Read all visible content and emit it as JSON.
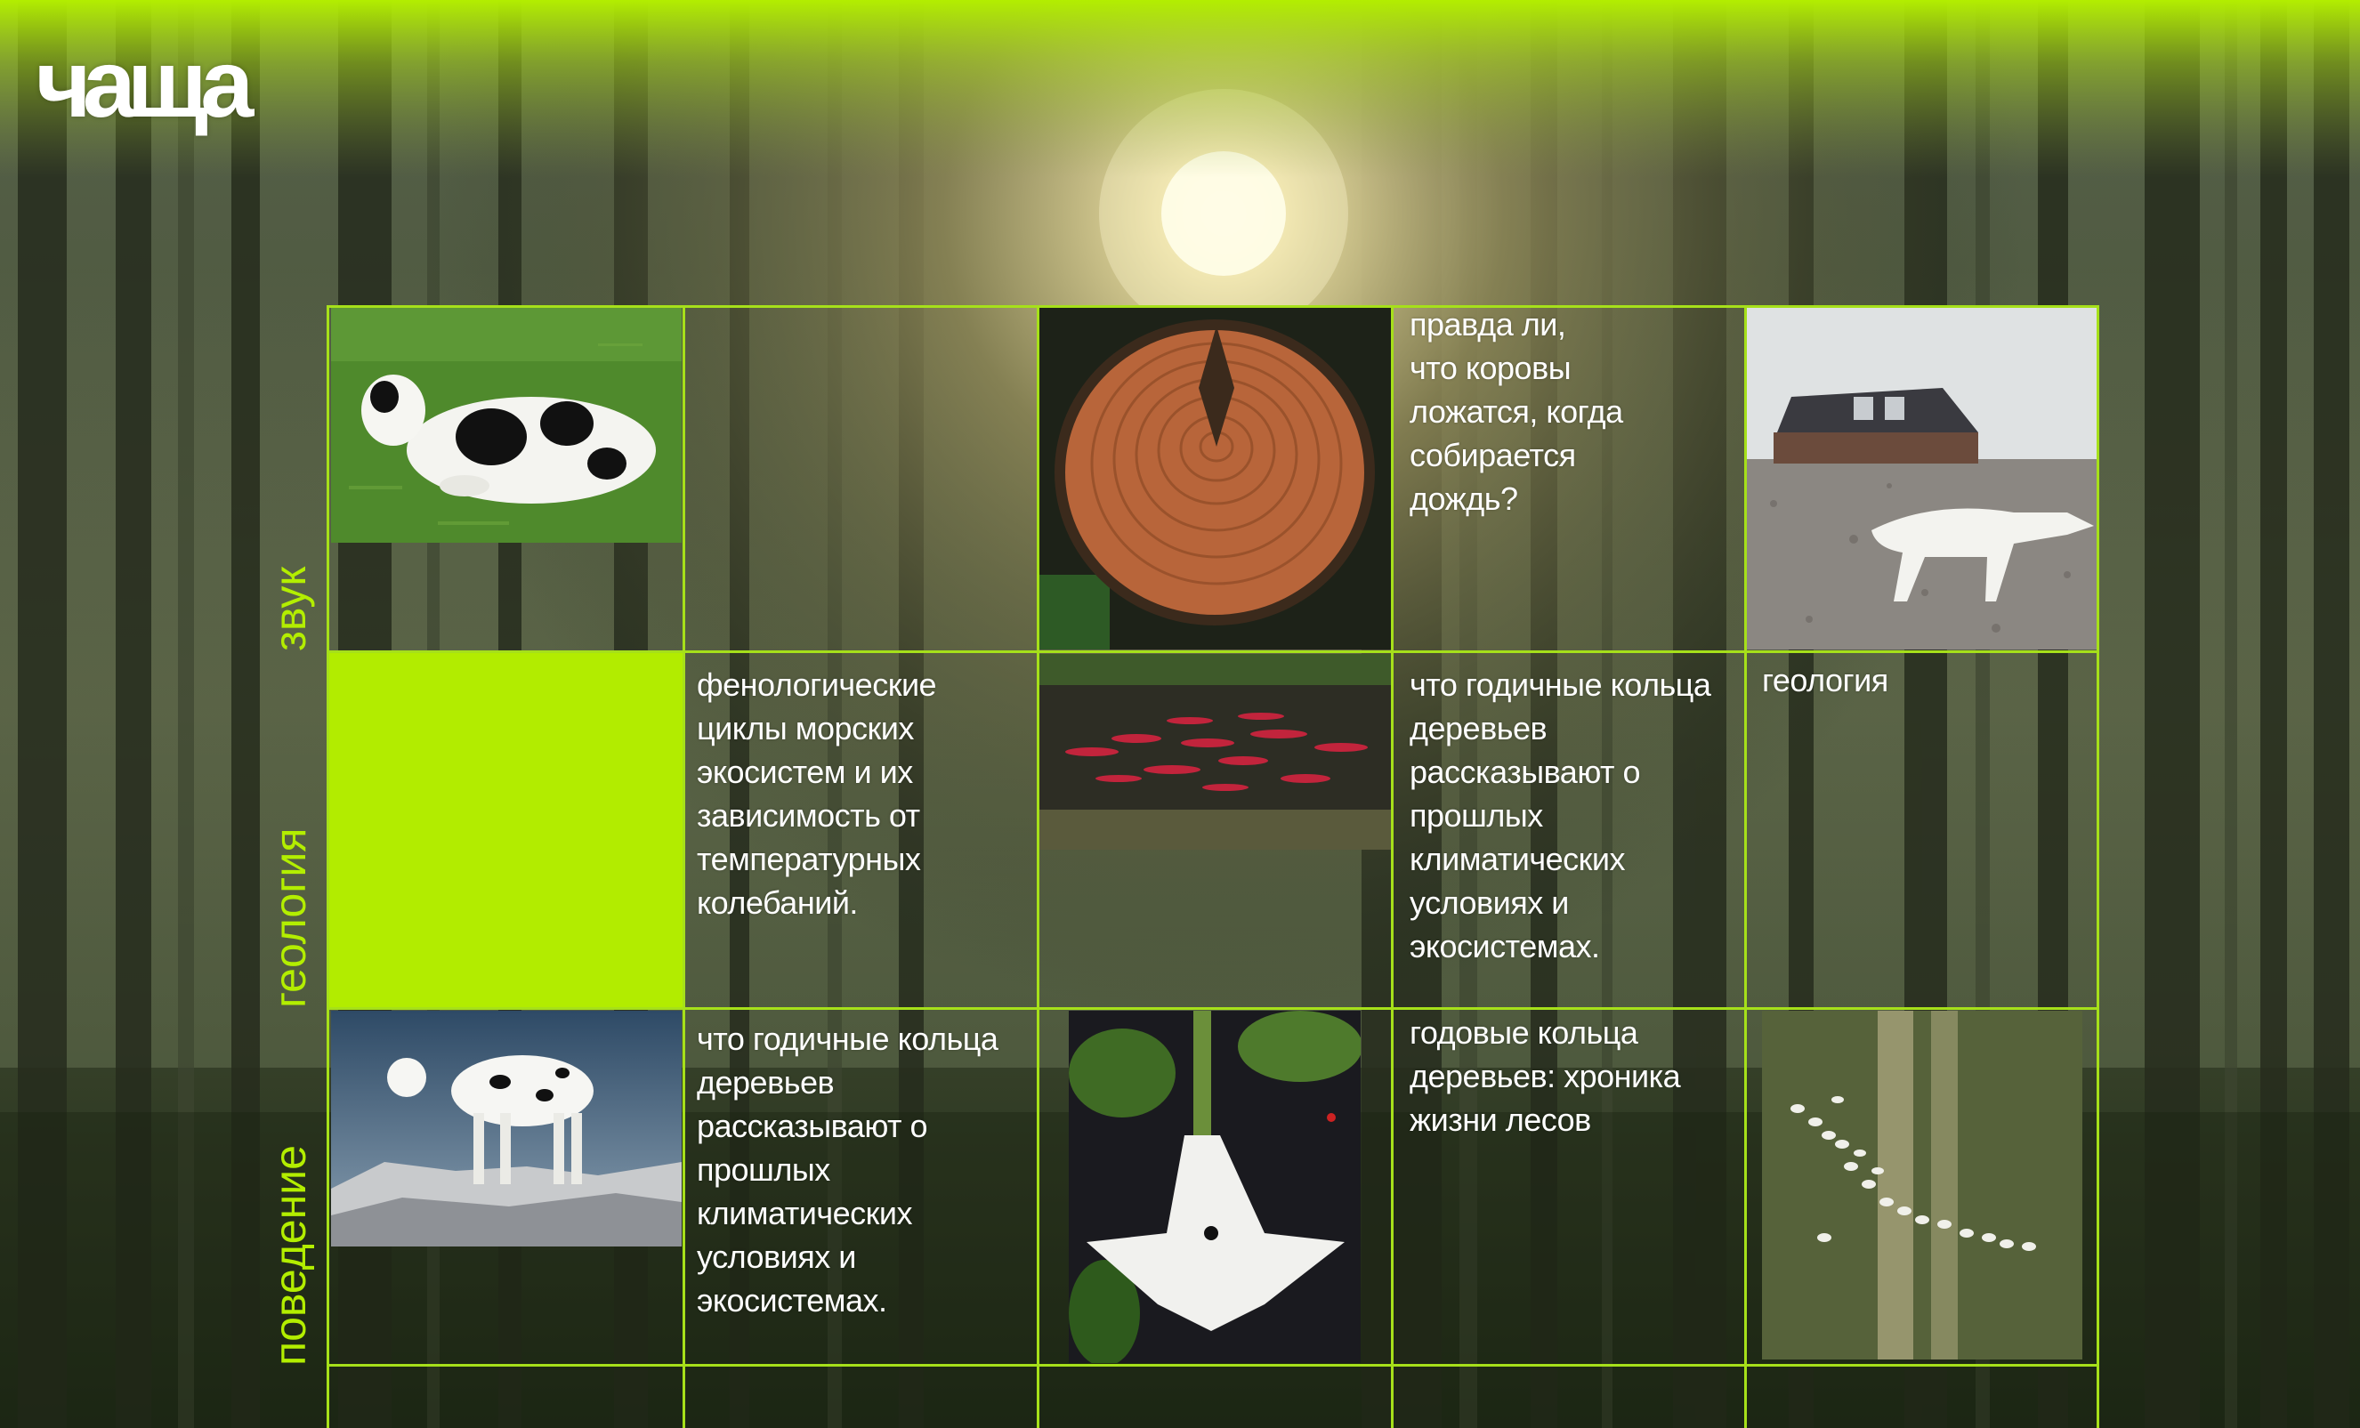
{
  "brand": {
    "logo_text": "чаща",
    "accent_color": "#b2ec00",
    "grid_color": "#a6e01a"
  },
  "rows": [
    {
      "label": "звук"
    },
    {
      "label": "геология"
    },
    {
      "label": "поведение"
    }
  ],
  "cells": {
    "r1c4_text": "правда ли,\nчто коровы\nложатся, когда\nсобирается\nдождь?",
    "r2c2_text": "фенологические\nциклы морских\nэкосистем и их\nзависимость от\nтемпературных\nколебаний.",
    "r2c4_text": "что годичные кольца\nдеревьев\nрассказывают о\nпрошлых\nклиматических\nусловиях и\nэкосистемах.",
    "r2c5_text": "геология",
    "r3c2_text": "что годичные кольца\nдеревьев\nрассказывают о\nпрошлых\nклиматических\nусловиях и\nэкосистемах.",
    "r3c4_text": "годовые кольца\nдеревьев: хроника\nжизни лесов"
  },
  "images": {
    "r1c1": "cow-lying-on-grass",
    "r1c3": "tree-trunk-cross-section",
    "r1c5": "white-wolf-and-house",
    "r2c3": "red-salmon-in-river",
    "r3c1": "cow-standing-on-rocks",
    "r3c3": "white-trumpet-flower-with-spider",
    "r3c5": "sheep-flock-aerial-field"
  }
}
